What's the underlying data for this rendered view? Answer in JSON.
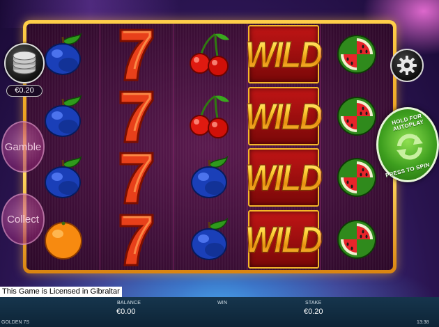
{
  "game": {
    "name": "GOLDEN 7S",
    "license_text": "This Game is Licensed in Gibraltar"
  },
  "controls": {
    "coin_value": "€0.20",
    "gamble_label": "Gamble",
    "collect_label": "Collect",
    "spin_top_text": "HOLD FOR AUTOPLAY",
    "spin_bottom_text": "PRESS TO SPIN",
    "settings_icon": "gear-icon",
    "spin_icon": "refresh-arrows-icon"
  },
  "reels": [
    [
      "plum",
      "plum",
      "plum",
      "orange"
    ],
    [
      "seven",
      "seven",
      "seven",
      "seven"
    ],
    [
      "cherry",
      "cherry",
      "plum",
      "plum"
    ],
    [
      "wild",
      "wild",
      "wild",
      "wild"
    ],
    [
      "watermelon",
      "watermelon",
      "watermelon",
      "watermelon"
    ]
  ],
  "wild_text": "WILD",
  "footer": {
    "balance_label": "BALANCE",
    "balance_value": "€0.00",
    "win_label": "WIN",
    "stake_label": "STAKE",
    "stake_value": "€0.20",
    "clock": "13:38"
  },
  "colors": {
    "frame_gold": "#f2b02a",
    "reel_background": "#4a1242",
    "spin_green": "#3d9e1e",
    "footer_bg": "#10293c"
  }
}
